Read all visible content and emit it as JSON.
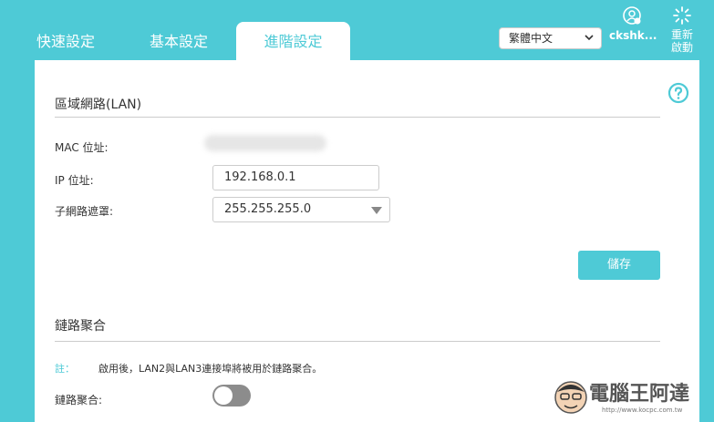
{
  "tabs": [
    {
      "label": "快速設定",
      "active": false
    },
    {
      "label": "基本設定",
      "active": false
    },
    {
      "label": "進階設定",
      "active": true
    }
  ],
  "header": {
    "language": "繁體中文",
    "user": "ckshk...",
    "reboot": "重新啟動"
  },
  "lan": {
    "title": "區域網路(LAN)",
    "mac_label": "MAC 位址:",
    "ip_label": "IP 位址:",
    "ip_value": "192.168.0.1",
    "mask_label": "子網路遮罩:",
    "mask_value": "255.255.255.0",
    "save_label": "儲存"
  },
  "link_aggregation": {
    "title": "鏈路聚合",
    "note_label": "註：",
    "note_text": "啟用後，LAN2與LAN3連接埠將被用於鏈路聚合。",
    "toggle_label": "鏈路聚合:",
    "enabled": false
  },
  "watermark": {
    "title": "電腦王阿達",
    "url": "http://www.kocpc.com.tw"
  },
  "colors": {
    "accent": "#4ecad6",
    "toggle_off": "#8c8c8c"
  }
}
